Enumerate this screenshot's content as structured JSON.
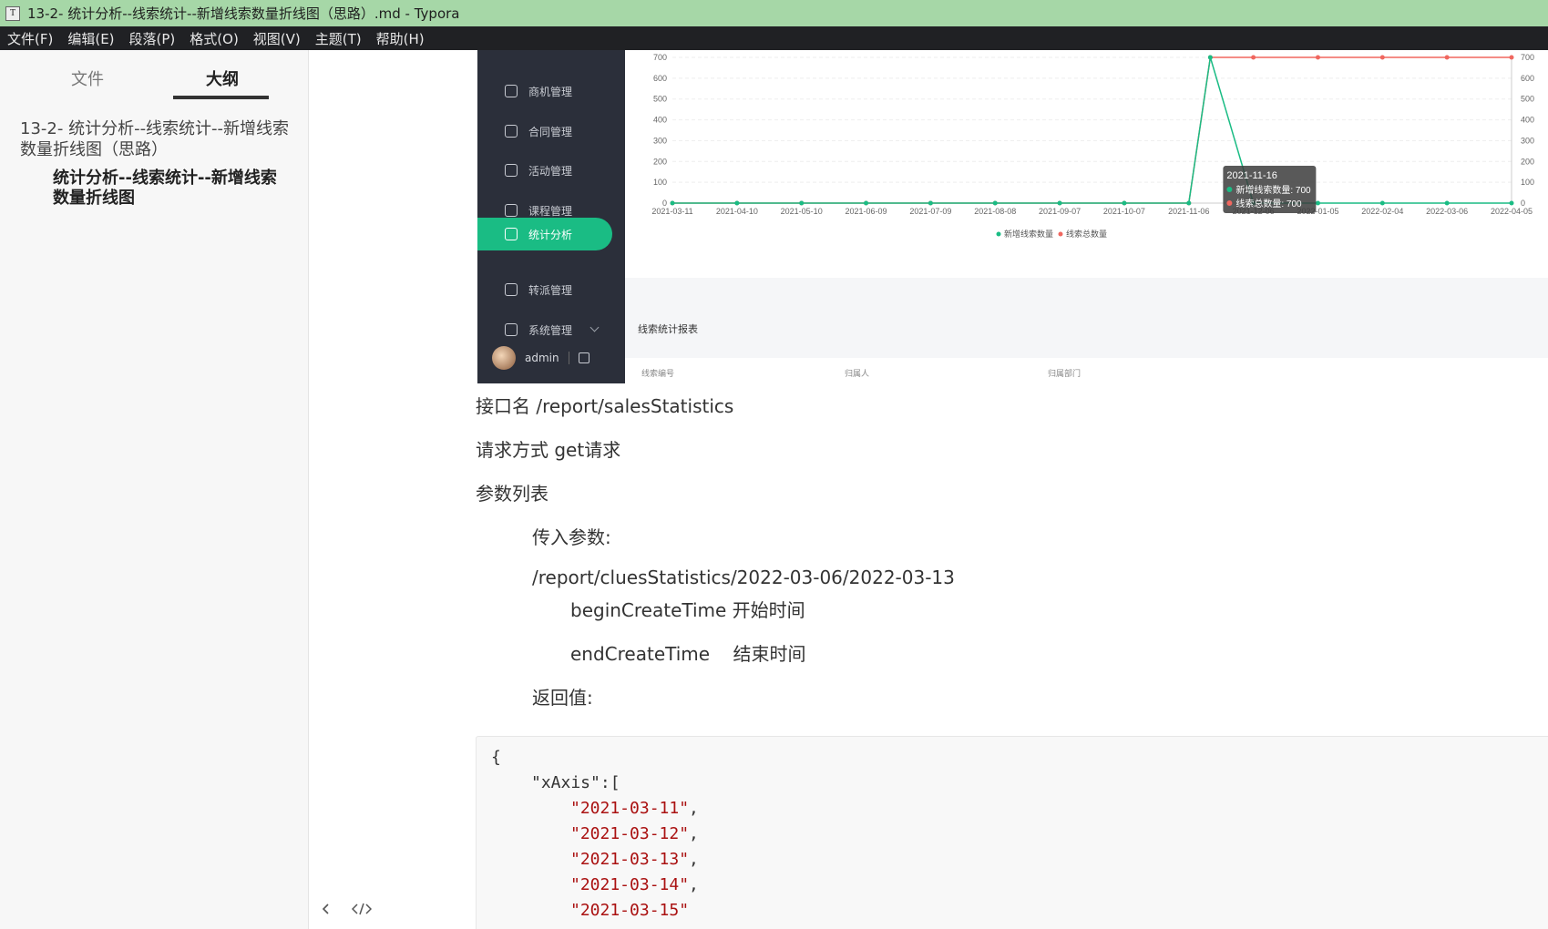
{
  "window": {
    "title": "13-2- 统计分析--线索统计--新增线索数量折线图（思路）.md - Typora",
    "icon": "T"
  },
  "menu": [
    "文件(F)",
    "编辑(E)",
    "段落(P)",
    "格式(O)",
    "视图(V)",
    "主题(T)",
    "帮助(H)"
  ],
  "sidebar": {
    "tabs": [
      "文件",
      "大纲"
    ],
    "outline": [
      "13-2- 统计分析--线索统计--新增线索数量折线图（思路）",
      "统计分析--线索统计--新增线索数量折线图"
    ],
    "bottom_icons": [
      "chevron-left-icon",
      "code-icon"
    ]
  },
  "shot": {
    "nav": [
      {
        "label": "商机管理",
        "icon": "target-icon"
      },
      {
        "label": "合同管理",
        "icon": "document-icon"
      },
      {
        "label": "活动管理",
        "icon": "star-icon"
      },
      {
        "label": "课程管理",
        "icon": "play-icon"
      },
      {
        "label": "统计分析",
        "icon": "chart-icon"
      },
      {
        "label": "转派管理",
        "icon": "refresh-icon"
      },
      {
        "label": "系统管理",
        "icon": "gear-icon"
      }
    ],
    "active_nav": "统计分析",
    "user": "admin",
    "report_title": "线索统计报表",
    "form": {
      "labels": [
        "线索编号",
        "归属人",
        "归属部门"
      ]
    },
    "accent": "#1abc84"
  },
  "chart_data": {
    "type": "line",
    "x": [
      "2021-03-11",
      "2021-04-10",
      "2021-05-10",
      "2021-06-09",
      "2021-07-09",
      "2021-08-08",
      "2021-09-07",
      "2021-10-07",
      "2021-11-06",
      "2021-11-16",
      "2021-12-06",
      "2022-01-05",
      "2022-02-04",
      "2022-03-06",
      "2022-04-05"
    ],
    "x_ticks": [
      "2021-03-11",
      "2021-04-10",
      "2021-05-10",
      "2021-06-09",
      "2021-07-09",
      "2021-08-08",
      "2021-09-07",
      "2021-10-07",
      "2021-11-06",
      "2021-12-06",
      "2022-01-05",
      "2022-02-04",
      "2022-03-06",
      "2022-04-05"
    ],
    "series": [
      {
        "name": "新增线索数量",
        "color": "#1abc84",
        "values": [
          0,
          0,
          0,
          0,
          0,
          0,
          0,
          0,
          0,
          700,
          0,
          0,
          0,
          0,
          0
        ]
      },
      {
        "name": "线索总数量",
        "color": "#f0675f",
        "values": [
          0,
          0,
          0,
          0,
          0,
          0,
          0,
          0,
          0,
          700,
          700,
          700,
          700,
          700,
          700
        ]
      }
    ],
    "ylim": [
      0,
      700
    ],
    "yticks": [
      0,
      100,
      200,
      300,
      400,
      500,
      600,
      700
    ],
    "legend": "bottom",
    "grid": true,
    "tooltip": {
      "title": "2021-11-16",
      "lines": [
        "新增线索数量: 700",
        "线索总数量: 700"
      ]
    }
  },
  "doc": {
    "api_line": "接口名 /report/salesStatistics",
    "method_line": "请求方式 get请求",
    "params_title": "参数列表",
    "input_params": "传入参数:",
    "example_path": "/report/cluesStatistics/2022-03-06/2022-03-13",
    "begin_param": "beginCreateTime 开始时间",
    "end_param": "endCreateTime    结束时间",
    "return_label": "返回值:"
  },
  "code": {
    "open_brace": "{",
    "xaxis_key": "\"xAxis\":[",
    "strings": [
      "\"2021-03-11\"",
      "\"2021-03-12\"",
      "\"2021-03-13\"",
      "\"2021-03-14\"",
      "\"2021-03-15\""
    ],
    "comma": ","
  }
}
